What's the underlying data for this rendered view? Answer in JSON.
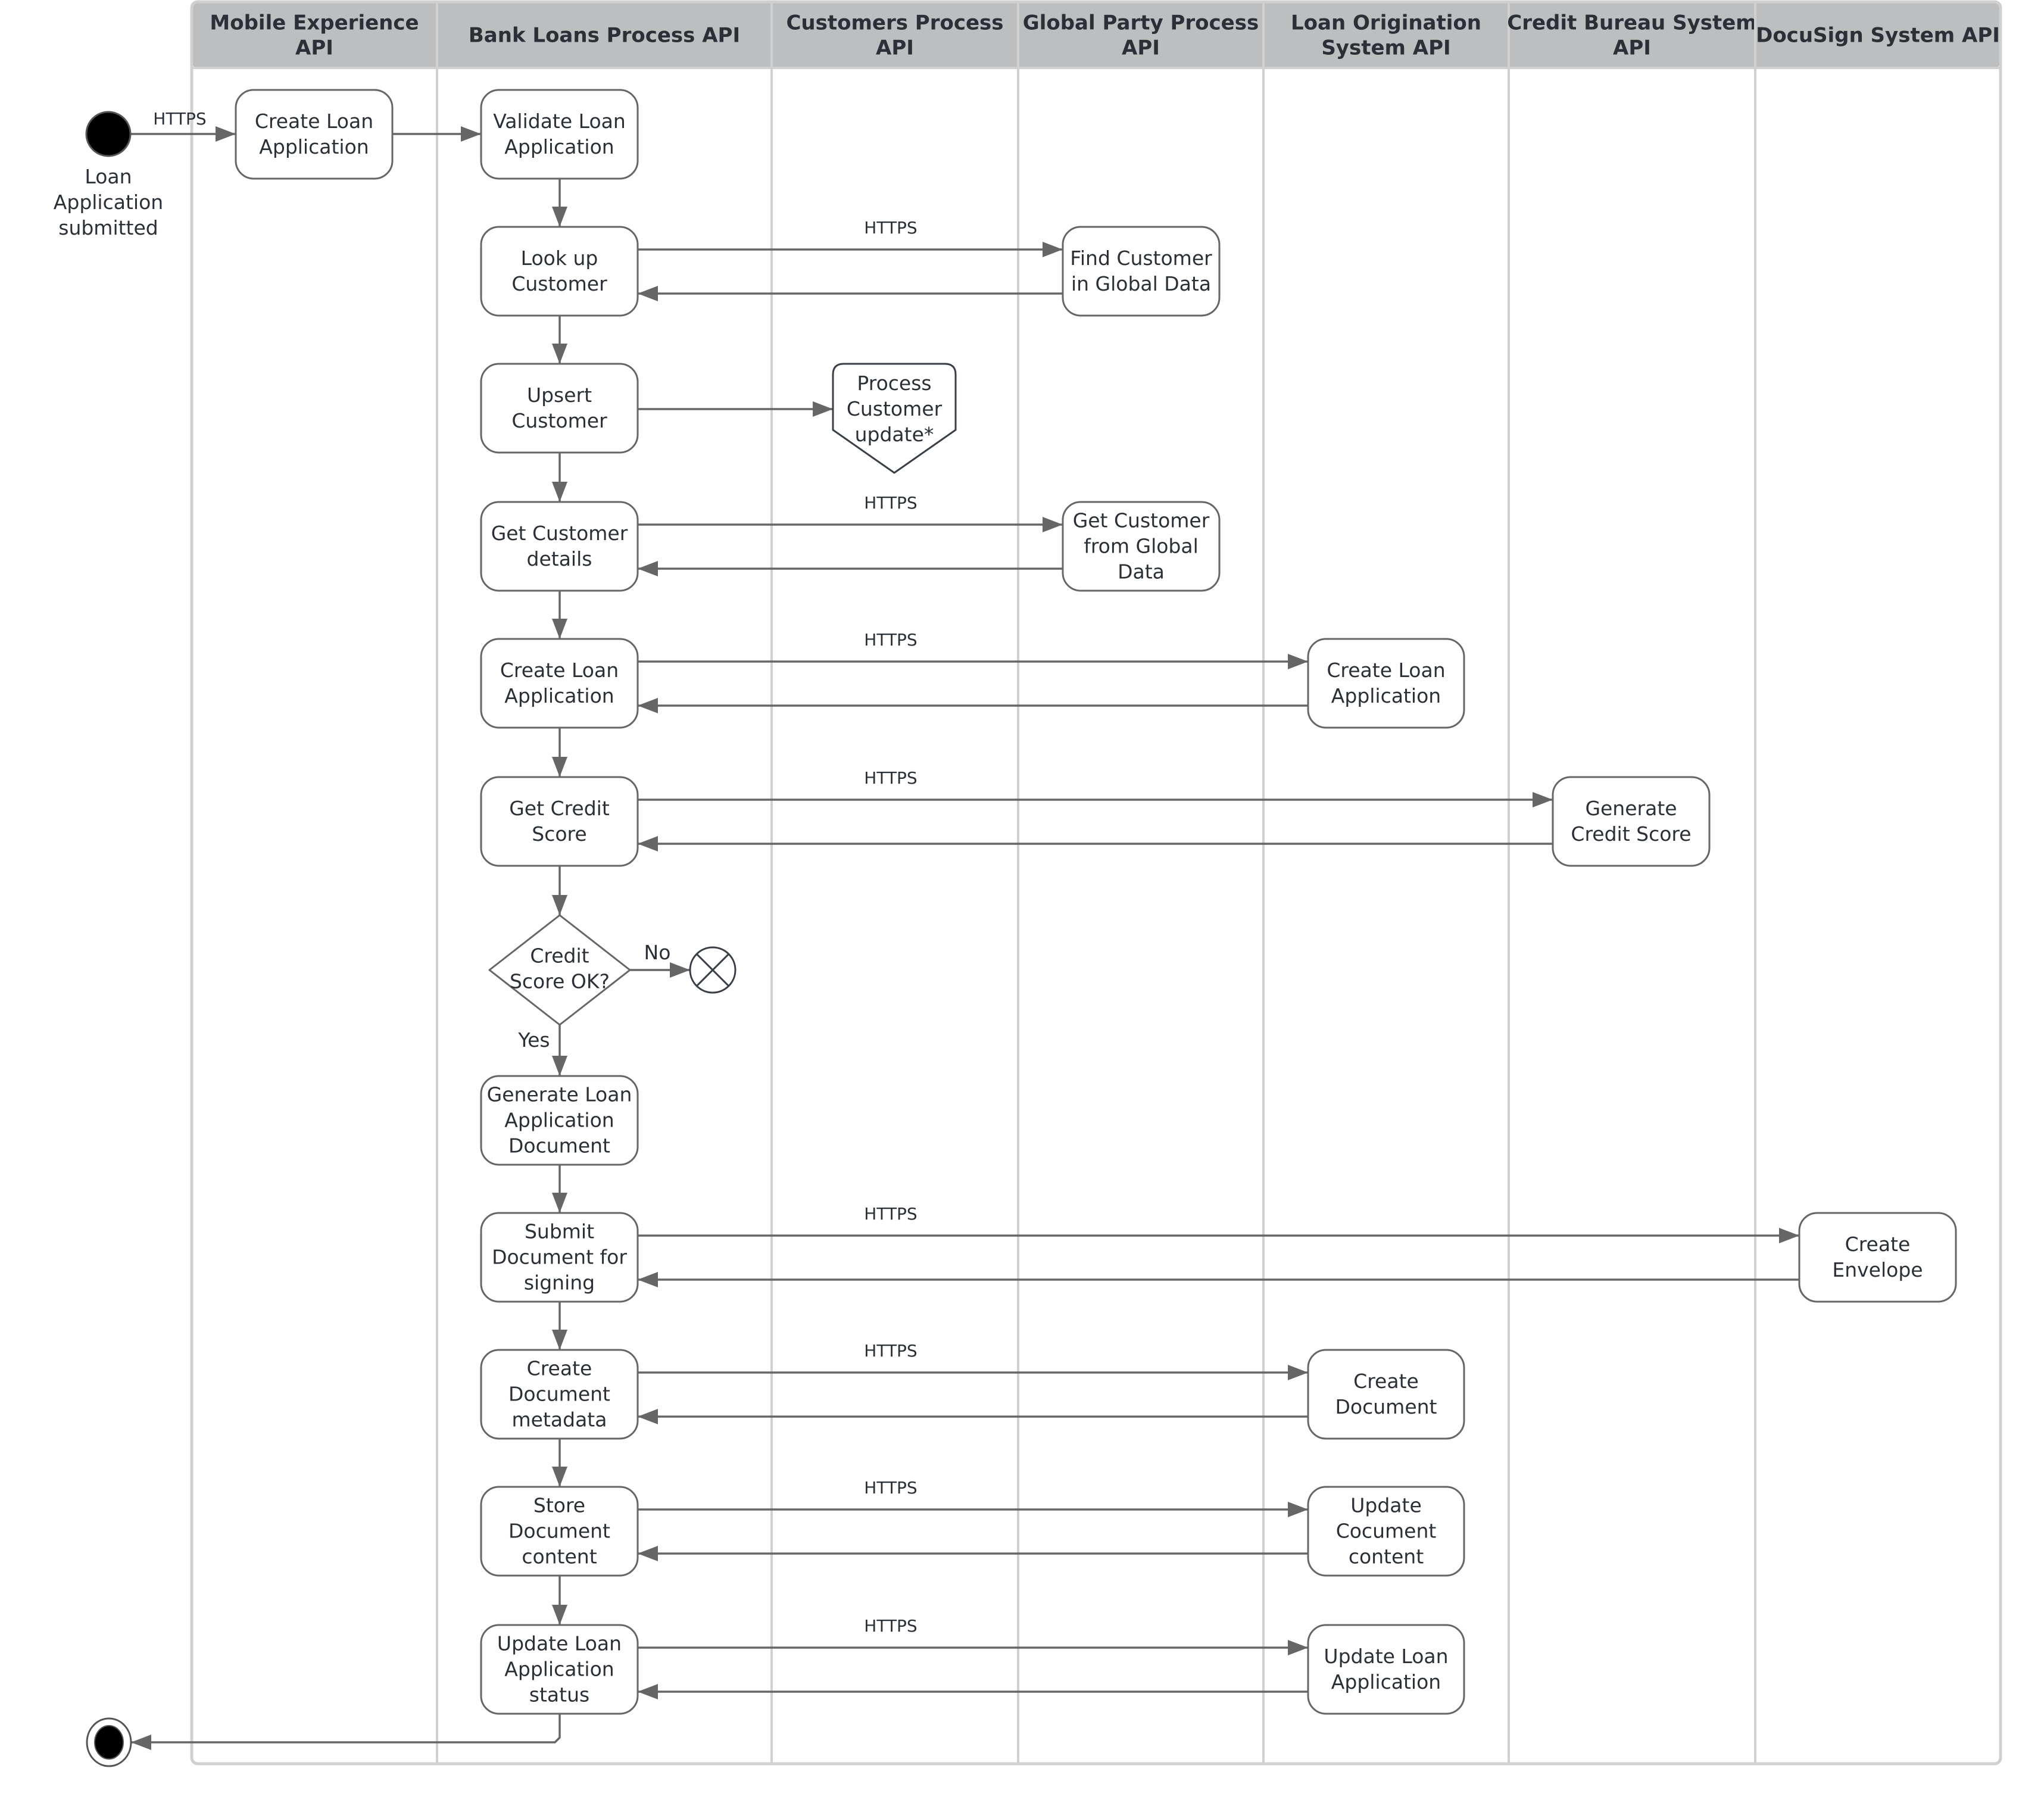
{
  "diagram": {
    "type": "UML activity diagram with swimlanes",
    "lanes": [
      {
        "id": "mobile",
        "title": [
          "Mobile Experience",
          "API"
        ]
      },
      {
        "id": "bank",
        "title": [
          "Bank Loans Process API"
        ]
      },
      {
        "id": "customers",
        "title": [
          "Customers Process",
          "API"
        ]
      },
      {
        "id": "global",
        "title": [
          "Global Party Process",
          "API"
        ]
      },
      {
        "id": "origination",
        "title": [
          "Loan Origination",
          "System API"
        ]
      },
      {
        "id": "credit",
        "title": [
          "Credit Bureau System",
          "API"
        ]
      },
      {
        "id": "docusign",
        "title": [
          "DocuSign System API"
        ]
      }
    ],
    "start": {
      "label": [
        "Loan",
        "Application",
        "submitted"
      ]
    },
    "nodes": {
      "mobile_create": {
        "lane": "mobile",
        "text": [
          "Create Loan",
          "Application"
        ]
      },
      "validate": {
        "lane": "bank",
        "text": [
          "Validate Loan",
          "Application"
        ]
      },
      "lookup": {
        "lane": "bank",
        "text": [
          "Look up",
          "Customer"
        ]
      },
      "upsert": {
        "lane": "bank",
        "text": [
          "Upsert",
          "Customer"
        ]
      },
      "get_details": {
        "lane": "bank",
        "text": [
          "Get Customer",
          "details"
        ]
      },
      "bank_create": {
        "lane": "bank",
        "text": [
          "Create Loan",
          "Application"
        ]
      },
      "get_score": {
        "lane": "bank",
        "text": [
          "Get Credit",
          "Score"
        ]
      },
      "decision": {
        "lane": "bank",
        "text": [
          "Credit",
          "Score OK?"
        ]
      },
      "gen_doc": {
        "lane": "bank",
        "text": [
          "Generate Loan",
          "Application",
          "Document"
        ]
      },
      "submit_doc": {
        "lane": "bank",
        "text": [
          "Submit",
          "Document for",
          "signing"
        ]
      },
      "create_meta": {
        "lane": "bank",
        "text": [
          "Create",
          "Document",
          "metadata"
        ]
      },
      "store_content": {
        "lane": "bank",
        "text": [
          "Store",
          "Document",
          "content"
        ]
      },
      "update_status": {
        "lane": "bank",
        "text": [
          "Update Loan",
          "Application",
          "status"
        ]
      },
      "process_update": {
        "lane": "customers",
        "text": [
          "Process",
          "Customer",
          "update*"
        ]
      },
      "find_global": {
        "lane": "global",
        "text": [
          "Find Customer",
          "in Global Data"
        ]
      },
      "get_global": {
        "lane": "global",
        "text": [
          "Get Customer",
          "from Global",
          "Data"
        ]
      },
      "lo_create": {
        "lane": "origination",
        "text": [
          "Create Loan",
          "Application"
        ]
      },
      "lo_create_doc": {
        "lane": "origination",
        "text": [
          "Create",
          "Document"
        ]
      },
      "lo_update_content": {
        "lane": "origination",
        "text": [
          "Update",
          "Cocument",
          "content"
        ]
      },
      "lo_update_app": {
        "lane": "origination",
        "text": [
          "Update Loan",
          "Application"
        ]
      },
      "gen_score": {
        "lane": "credit",
        "text": [
          "Generate",
          "Credit Score"
        ]
      },
      "create_envelope": {
        "lane": "docusign",
        "text": [
          "Create",
          "Envelope"
        ]
      }
    },
    "edge_labels": {
      "https": "HTTPS",
      "yes": "Yes",
      "no": "No"
    },
    "calls": [
      {
        "from": "lookup",
        "to": "find_global",
        "label": "HTTPS"
      },
      {
        "from": "get_details",
        "to": "get_global",
        "label": "HTTPS"
      },
      {
        "from": "bank_create",
        "to": "lo_create",
        "label": "HTTPS"
      },
      {
        "from": "get_score",
        "to": "gen_score",
        "label": "HTTPS"
      },
      {
        "from": "submit_doc",
        "to": "create_envelope",
        "label": "HTTPS"
      },
      {
        "from": "create_meta",
        "to": "lo_create_doc",
        "label": "HTTPS"
      },
      {
        "from": "store_content",
        "to": "lo_update_content",
        "label": "HTTPS"
      },
      {
        "from": "update_status",
        "to": "lo_update_app",
        "label": "HTTPS"
      }
    ],
    "colors": {
      "header_bg": "#bdbec0",
      "lane_border": "#d0d0d0",
      "line": "#666666",
      "text": "#2b2f36"
    }
  }
}
